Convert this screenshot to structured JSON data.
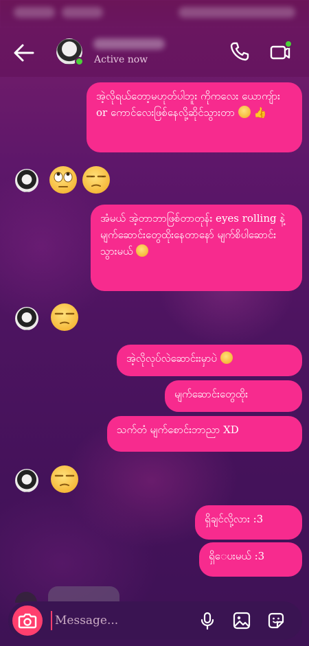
{
  "header": {
    "active_status": "Active now"
  },
  "messages": {
    "m1": "အဲ့လိုရယ်တော့မဟုတ်ပါဘူး ကိုကလေး ယောကျ်ား or ကောင်လေးဖြစ်နေလို့ဆိုင်သွားတာ",
    "m2": "အံမယ် အဲ့တာဘာဖြစ်တာတုန်း eyes rolling နဲ့မျက်ဆောင်းတွေထိုးနေတာနော် မျက်စိပါဆောင်းသွားမယ်",
    "m3": "အဲ့လိုလုပ်လဲဆောင်းးမှာပဲ",
    "m4": "မျက်ဆောင်းတွေထိုး",
    "m5": "သက်တံ မျက်စောင်းဘာညာ XD",
    "m6": "ရှိချင်လို့လား :3",
    "m7": "ရှိေပးမယ် :3"
  },
  "icons": {
    "reply1": "eye-roll-emoji",
    "reply1b": "unamused-emoji",
    "reply2": "unamused-emoji",
    "reply3": "unamused-emoji"
  },
  "composer": {
    "placeholder": "Message..."
  },
  "colors": {
    "bubble": "#f72b8e",
    "accent": "#ff3f6e",
    "online": "#4cd23a"
  }
}
